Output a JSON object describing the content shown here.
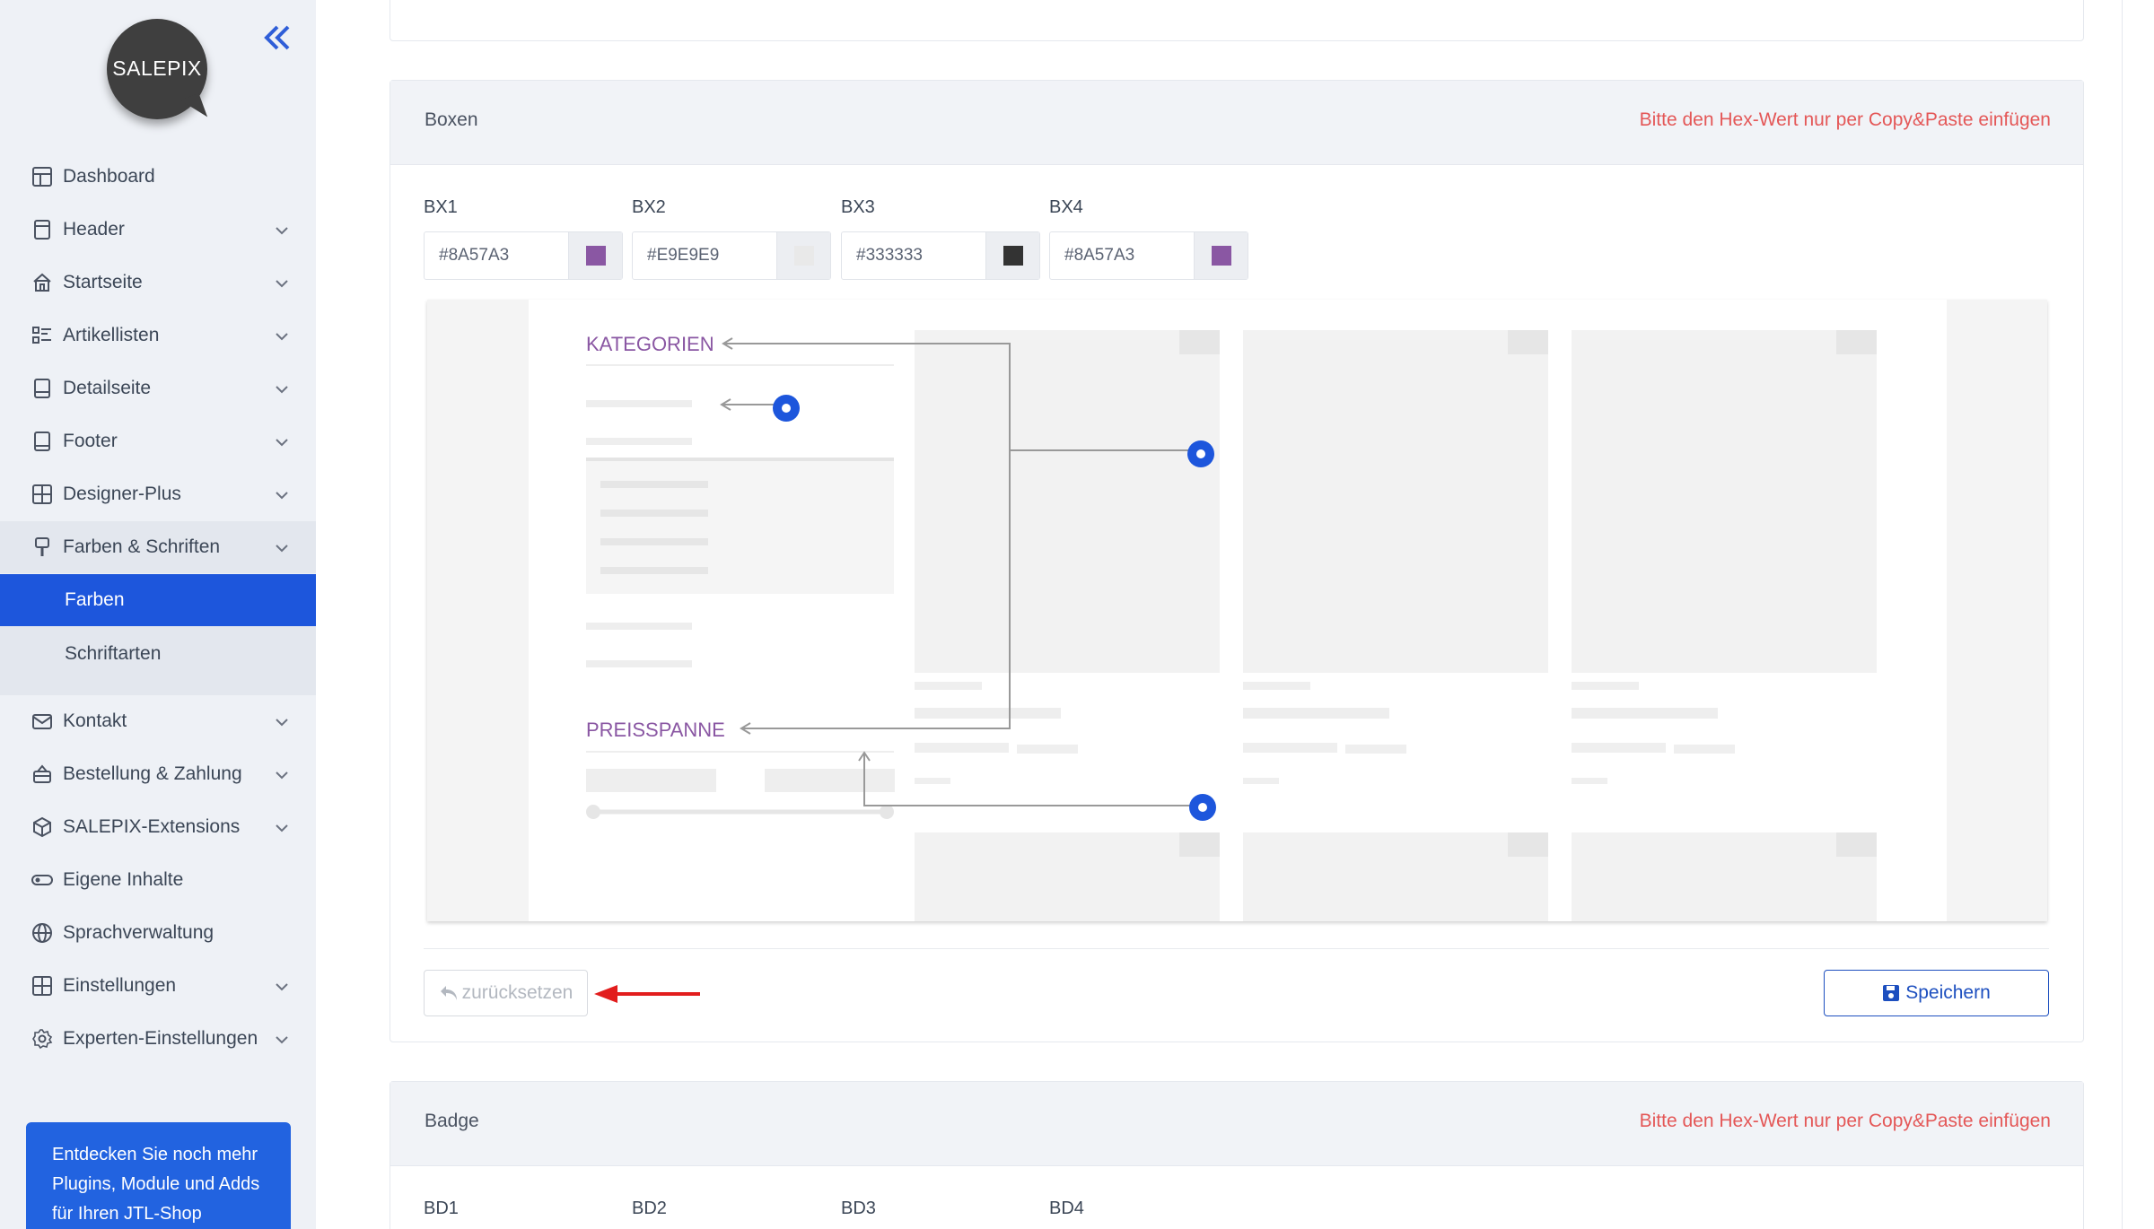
{
  "sidebar": {
    "logo_text": "SALEPIX",
    "items": [
      {
        "label": "Dashboard",
        "icon": "dashboard-icon"
      },
      {
        "label": "Header",
        "icon": "header-icon"
      },
      {
        "label": "Startseite",
        "icon": "home-icon"
      },
      {
        "label": "Artikellisten",
        "icon": "list-icon"
      },
      {
        "label": "Detailseite",
        "icon": "detail-page-icon"
      },
      {
        "label": "Footer",
        "icon": "footer-icon"
      },
      {
        "label": "Designer-Plus",
        "icon": "grid-icon"
      },
      {
        "label": "Farben & Schriften",
        "icon": "paint-brush-icon"
      },
      {
        "label": "Farben",
        "icon": ""
      },
      {
        "label": "Schriftarten",
        "icon": ""
      },
      {
        "label": "Kontakt",
        "icon": "mail-icon"
      },
      {
        "label": "Bestellung & Zahlung",
        "icon": "basket-icon"
      },
      {
        "label": "SALEPIX-Extensions",
        "icon": "cube-icon"
      },
      {
        "label": "Eigene Inhalte",
        "icon": "toggle-icon"
      },
      {
        "label": "Sprachverwaltung",
        "icon": "globe-icon"
      },
      {
        "label": "Einstellungen",
        "icon": "settings-grid-icon"
      },
      {
        "label": "Experten-Einstellungen",
        "icon": "gear-icon"
      }
    ],
    "promo_text": "Entdecken Sie noch mehr Plugins, Module und Adds für Ihren JTL-Shop"
  },
  "boxen": {
    "title": "Boxen",
    "hint": "Bitte den Hex-Wert nur per Copy&Paste einfügen",
    "fields": [
      {
        "label": "BX1",
        "value": "#8A57A3",
        "swatch": "#8A57A3"
      },
      {
        "label": "BX2",
        "value": "#E9E9E9",
        "swatch": "#E9E9E9"
      },
      {
        "label": "BX3",
        "value": "#333333",
        "swatch": "#333333"
      },
      {
        "label": "BX4",
        "value": "#8A57A3",
        "swatch": "#8A57A3"
      }
    ],
    "preview": {
      "label_kategorien": "KATEGORIEN",
      "label_preisspanne": "PREISSPANNE"
    },
    "reset_label": "zurücksetzen",
    "save_label": "Speichern"
  },
  "badge": {
    "title": "Badge",
    "hint": "Bitte den Hex-Wert nur per Copy&Paste einfügen",
    "fields": [
      {
        "label": "BD1"
      },
      {
        "label": "BD2"
      },
      {
        "label": "BD3"
      },
      {
        "label": "BD4"
      }
    ]
  },
  "colors": {
    "accent": "#1D56DC",
    "hint": "#E45757",
    "preview_purple": "#8A57A3"
  }
}
